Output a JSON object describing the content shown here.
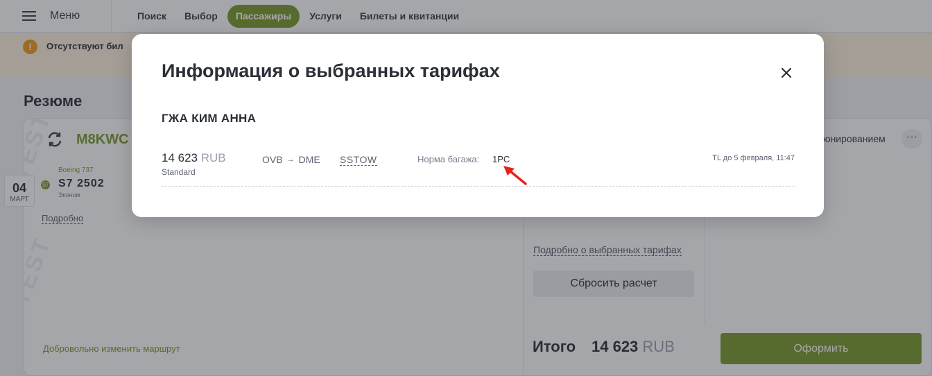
{
  "topbar": {
    "menu_label": "Меню",
    "tabs": [
      {
        "label": "Поиск",
        "active": false
      },
      {
        "label": "Выбор",
        "active": false
      },
      {
        "label": "Пассажиры",
        "active": true
      },
      {
        "label": "Услуги",
        "active": false
      },
      {
        "label": "Билеты и квитанции",
        "active": false
      }
    ]
  },
  "warning": {
    "text": "Отсутствуют бил"
  },
  "summary": {
    "title": "Резюме",
    "pnr": "M8KWC",
    "date_day": "04",
    "date_month": "МАРТ",
    "aircraft": "Boeing 737",
    "flight": "S7  2502",
    "cabin": "Эконом",
    "detail_link": "Подробно",
    "change_route": "Добровольно изменить маршрут",
    "booking_text": "ронированием",
    "more_label": "···",
    "fares_link": "Подробно о выбранных тарифах",
    "reset_label": "Сбросить расчет",
    "total_label": "Итого",
    "total_amount": "14 623",
    "total_currency": "RUB",
    "checkout_label": "Оформить",
    "watermark": "TEST"
  },
  "modal": {
    "title": "Информация о выбранных тарифах",
    "passenger": "ГЖА КИМ АННА",
    "fare": {
      "price": "14 623",
      "currency": "RUB",
      "class": "Standard",
      "origin": "OVB",
      "destination": "DME",
      "route_arrow": "→",
      "code": "SSTOW",
      "baggage_label": "Норма багажа:",
      "baggage_value": "1PC",
      "ticketing_limit": "TL до 5 февраля, 11:47"
    }
  },
  "colors": {
    "accent": "#7a9a2b",
    "warning": "#f29a1a",
    "cursor": "#e8201a"
  }
}
